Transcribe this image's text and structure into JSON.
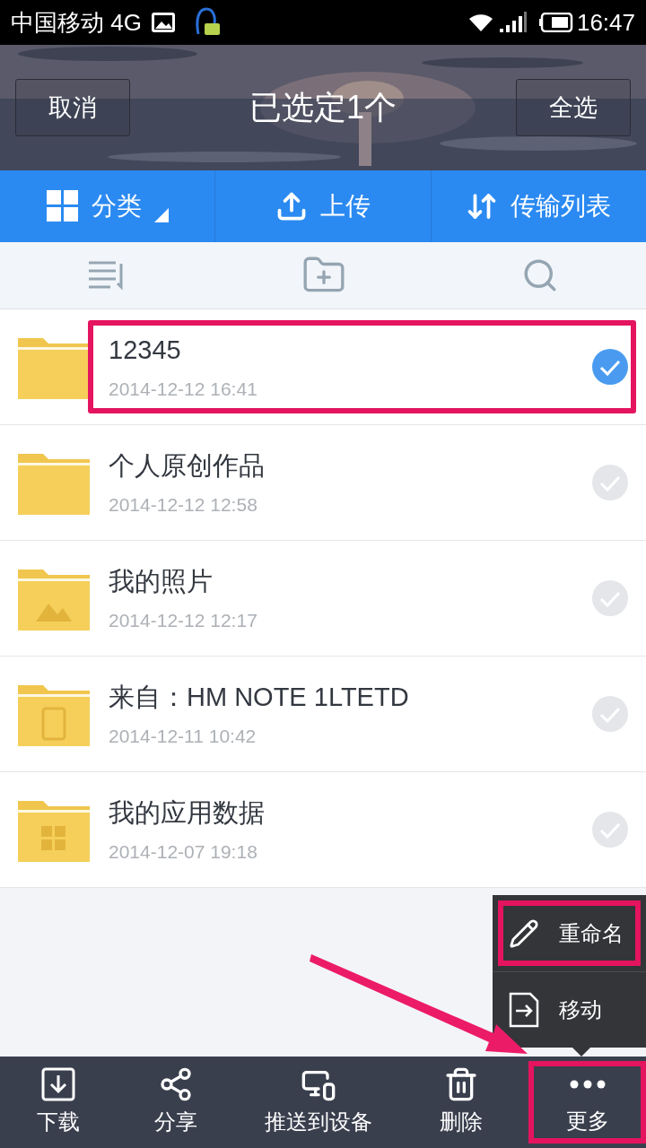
{
  "status_bar": {
    "carrier": "中国移动 4G",
    "time": "16:47"
  },
  "header": {
    "cancel": "取消",
    "title": "已选定1个",
    "select_all": "全选"
  },
  "tabs": [
    {
      "label": "分类",
      "kind": "grid",
      "dropdown": true
    },
    {
      "label": "上传",
      "kind": "upload",
      "dropdown": false
    },
    {
      "label": "传输列表",
      "kind": "transfer",
      "dropdown": false
    }
  ],
  "files": [
    {
      "name": "12345",
      "date": "2014-12-12  16:41",
      "kind": "plain",
      "selected": true,
      "highlighted": true
    },
    {
      "name": "个人原创作品",
      "date": "2014-12-12  12:58",
      "kind": "plain",
      "selected": false,
      "highlighted": false
    },
    {
      "name": "我的照片",
      "date": "2014-12-12  12:17",
      "kind": "photos",
      "selected": false,
      "highlighted": false
    },
    {
      "name": "来自：HM NOTE 1LTETD",
      "date": "2014-12-11  10:42",
      "kind": "device",
      "selected": false,
      "highlighted": false
    },
    {
      "name": "我的应用数据",
      "date": "2014-12-07  19:18",
      "kind": "apps",
      "selected": false,
      "highlighted": false
    }
  ],
  "menu": [
    {
      "label": "重命名",
      "kind": "rename",
      "highlighted": true
    },
    {
      "label": "移动",
      "kind": "move",
      "highlighted": false
    }
  ],
  "bottom_bar": [
    {
      "label": "下载",
      "kind": "download",
      "highlighted": false
    },
    {
      "label": "分享",
      "kind": "share",
      "highlighted": false
    },
    {
      "label": "推送到设备",
      "kind": "push",
      "highlighted": false
    },
    {
      "label": "删除",
      "kind": "delete",
      "highlighted": false
    },
    {
      "label": "更多",
      "kind": "more",
      "highlighted": true
    }
  ]
}
